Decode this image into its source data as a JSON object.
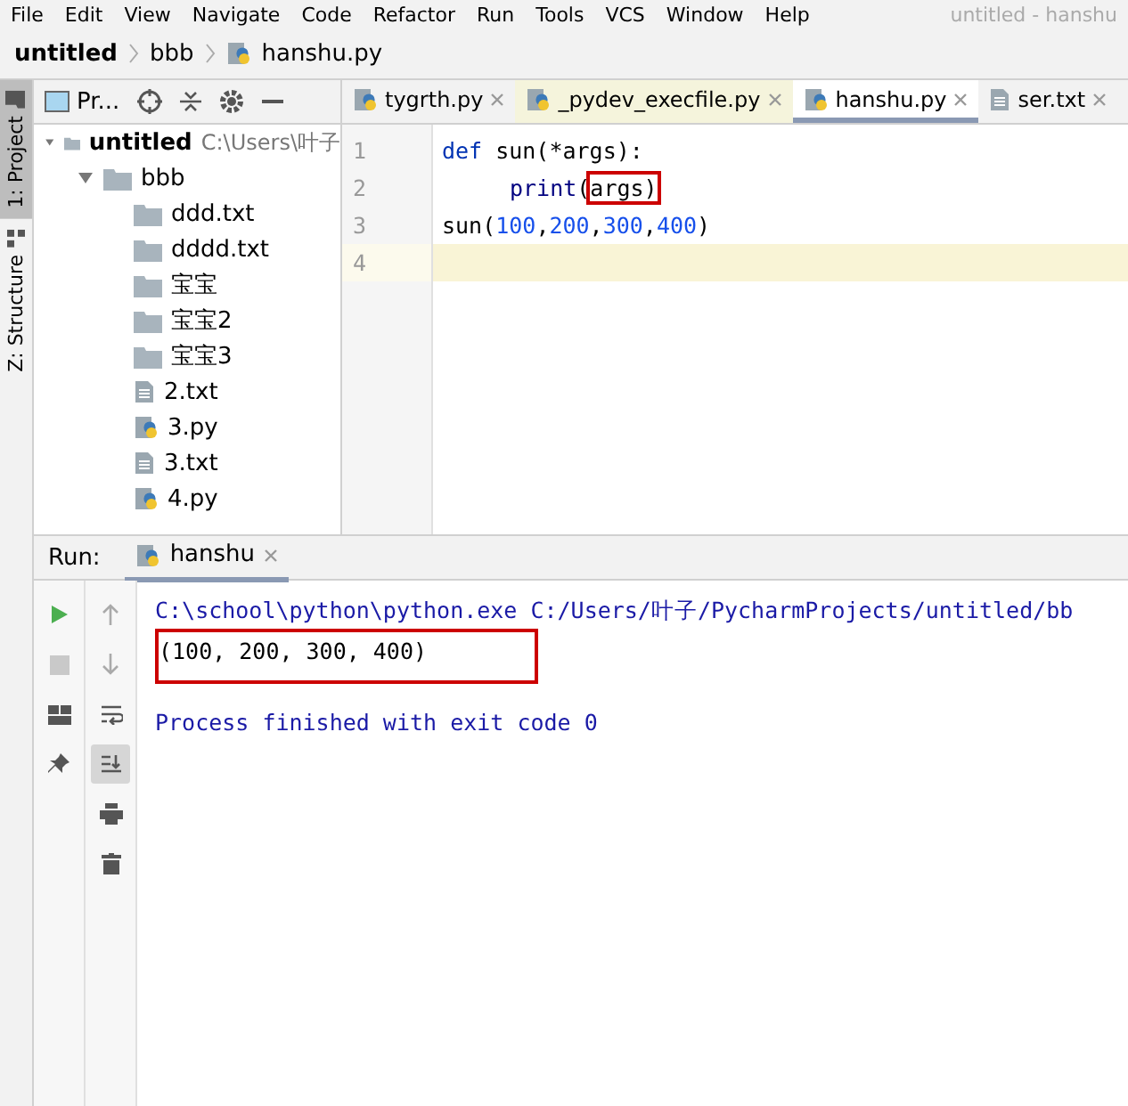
{
  "menu": [
    "File",
    "Edit",
    "View",
    "Navigate",
    "Code",
    "Refactor",
    "Run",
    "Tools",
    "VCS",
    "Window",
    "Help"
  ],
  "window_title": "untitled - hanshu",
  "breadcrumb": [
    {
      "label": "untitled",
      "kind": "root"
    },
    {
      "label": "bbb",
      "kind": "folder"
    },
    {
      "label": "hanshu.py",
      "kind": "python"
    }
  ],
  "side_tabs": [
    {
      "label": "1: Project",
      "selected": true,
      "kind": "folder"
    },
    {
      "label": "Z: Structure",
      "kind": "structure",
      "selected": false
    }
  ],
  "project_panel": {
    "title": "Pr...",
    "tree": [
      {
        "label": "untitled",
        "path": "C:\\Users\\叶子",
        "kind": "folder",
        "expanded": true,
        "children": [
          {
            "label": "bbb",
            "kind": "folder",
            "expanded": true,
            "children": [
              {
                "label": "ddd.txt",
                "kind": "folder"
              },
              {
                "label": "dddd.txt",
                "kind": "folder"
              },
              {
                "label": "宝宝",
                "kind": "folder"
              },
              {
                "label": "宝宝2",
                "kind": "folder"
              },
              {
                "label": "宝宝3",
                "kind": "folder"
              },
              {
                "label": "2.txt",
                "kind": "text"
              },
              {
                "label": "3.py",
                "kind": "python"
              },
              {
                "label": "3.txt",
                "kind": "text"
              },
              {
                "label": "4.py",
                "kind": "python"
              }
            ]
          }
        ]
      }
    ]
  },
  "editor_tabs": [
    {
      "label": "tygrth.py",
      "kind": "python",
      "selected": false,
      "tinted": false
    },
    {
      "label": "_pydev_execfile.py",
      "kind": "python",
      "selected": false,
      "tinted": true
    },
    {
      "label": "hanshu.py",
      "kind": "python",
      "selected": true,
      "tinted": false
    },
    {
      "label": "ser.txt",
      "kind": "text",
      "selected": false,
      "tinted": false
    }
  ],
  "code_lines": [
    {
      "number": "1",
      "current": false,
      "tokens": [
        {
          "text": "def ",
          "kind": "keyword"
        },
        {
          "text": "sun(*args):",
          "kind": "plain"
        }
      ]
    },
    {
      "number": "2",
      "current": false,
      "indented": true,
      "tokens": [
        {
          "text": "print",
          "kind": "builtin"
        },
        {
          "text": "(",
          "kind": "plain"
        },
        {
          "text": "args)",
          "kind": "plain",
          "boxed": true
        }
      ]
    },
    {
      "number": "3",
      "current": false,
      "tokens": [
        {
          "text": "sun(",
          "kind": "plain"
        },
        {
          "text": "100",
          "kind": "number"
        },
        {
          "text": ",",
          "kind": "plain"
        },
        {
          "text": "200",
          "kind": "number"
        },
        {
          "text": ",",
          "kind": "plain"
        },
        {
          "text": "300",
          "kind": "number"
        },
        {
          "text": ",",
          "kind": "plain"
        },
        {
          "text": "400",
          "kind": "number"
        },
        {
          "text": ")",
          "kind": "plain"
        }
      ]
    },
    {
      "number": "4",
      "current": true
    }
  ],
  "run_panel": {
    "label": "Run:",
    "tab": "hanshu",
    "left_tools": [
      {
        "kind": "run"
      },
      {
        "kind": "stop"
      },
      {
        "kind": "layout"
      },
      {
        "kind": "pin"
      }
    ],
    "right_tools": [
      {
        "kind": "up",
        "selected": false
      },
      {
        "kind": "down",
        "selected": false
      },
      {
        "kind": "wrap",
        "selected": false
      },
      {
        "kind": "scroll-end",
        "selected": true
      },
      {
        "kind": "print",
        "selected": false
      },
      {
        "kind": "trash",
        "selected": false
      }
    ],
    "output": [
      {
        "text": "C:\\school\\python\\python.exe C:/Users/叶子/PycharmProjects/untitled/bb",
        "kind": "system"
      },
      {
        "text": "(100, 200, 300, 400)",
        "kind": "stdout",
        "boxed": true
      },
      {
        "text": "Process finished with exit code 0",
        "kind": "system",
        "spaced": true
      }
    ]
  }
}
